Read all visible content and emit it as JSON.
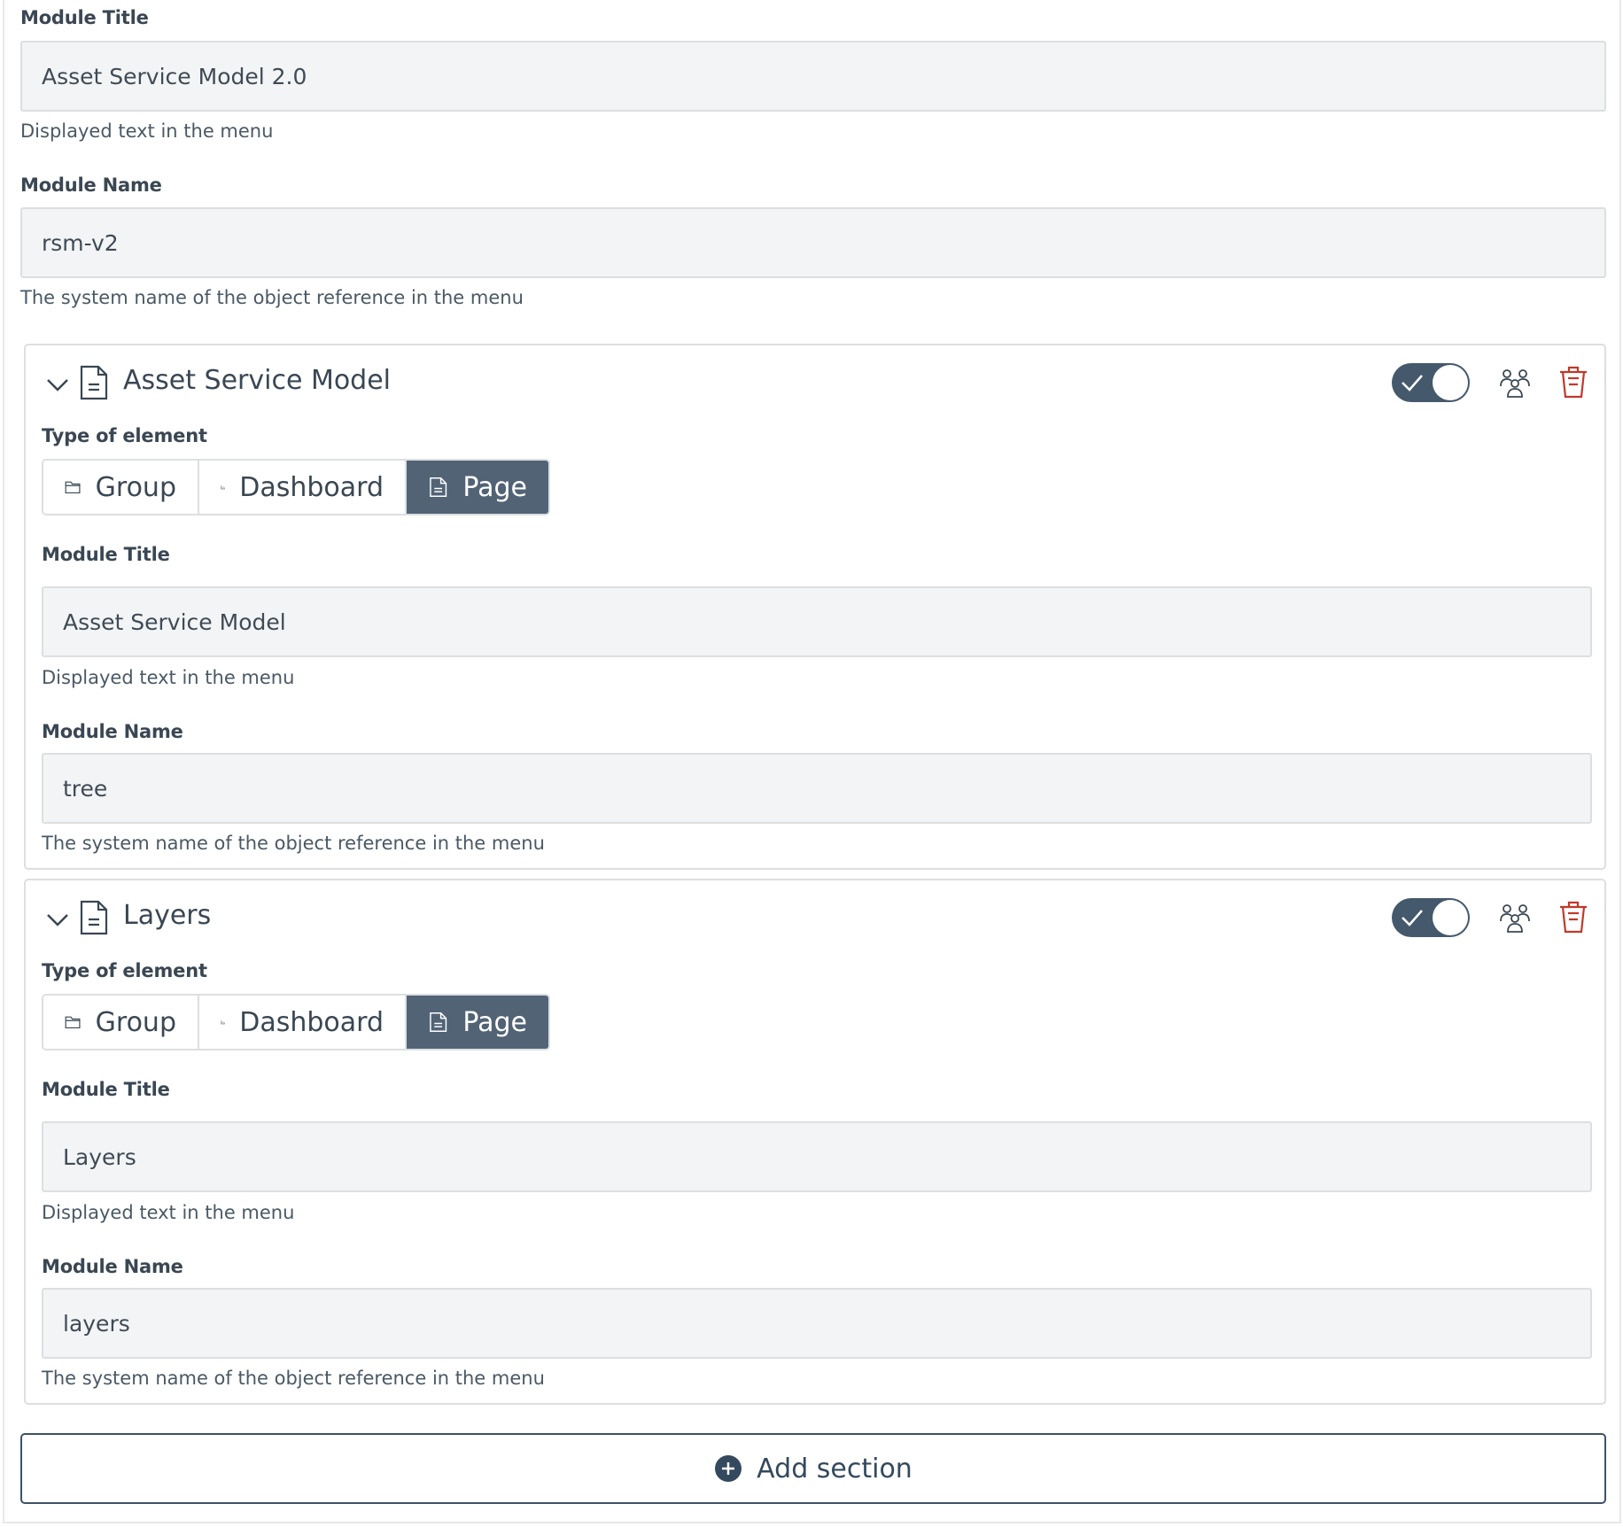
{
  "top": {
    "title_label": "Module Title",
    "title_value": "Asset Service Model 2.0",
    "title_help": "Displayed text in the menu",
    "name_label": "Module Name",
    "name_value": "rsm-v2",
    "name_help": "The system name of the object reference in the menu"
  },
  "sections": [
    {
      "title": "Asset Service Model",
      "enabled": true,
      "type_label": "Type of element",
      "types": [
        "Group",
        "Dashboard",
        "Page"
      ],
      "selected_type": "Page",
      "title_label": "Module Title",
      "title_value": "Asset Service Model",
      "title_help": "Displayed text in the menu",
      "name_label": "Module Name",
      "name_value": "tree",
      "name_help": "The system name of the object reference in the menu"
    },
    {
      "title": "Layers",
      "enabled": true,
      "type_label": "Type of element",
      "types": [
        "Group",
        "Dashboard",
        "Page"
      ],
      "selected_type": "Page",
      "title_label": "Module Title",
      "title_value": "Layers",
      "title_help": "Displayed text in the menu",
      "name_label": "Module Name",
      "name_value": "layers",
      "name_help": "The system name of the object reference in the menu"
    }
  ],
  "add_section_label": "Add section",
  "colors": {
    "accent": "#45596c",
    "segment_active": "#526375",
    "delete": "#c0392b",
    "input_bg": "#f3f4f5"
  },
  "icons": [
    "chevron-down-icon",
    "document-icon",
    "check-icon",
    "users-icon",
    "trash-icon",
    "folder-icon",
    "chart-icon",
    "plus-circle-icon"
  ]
}
